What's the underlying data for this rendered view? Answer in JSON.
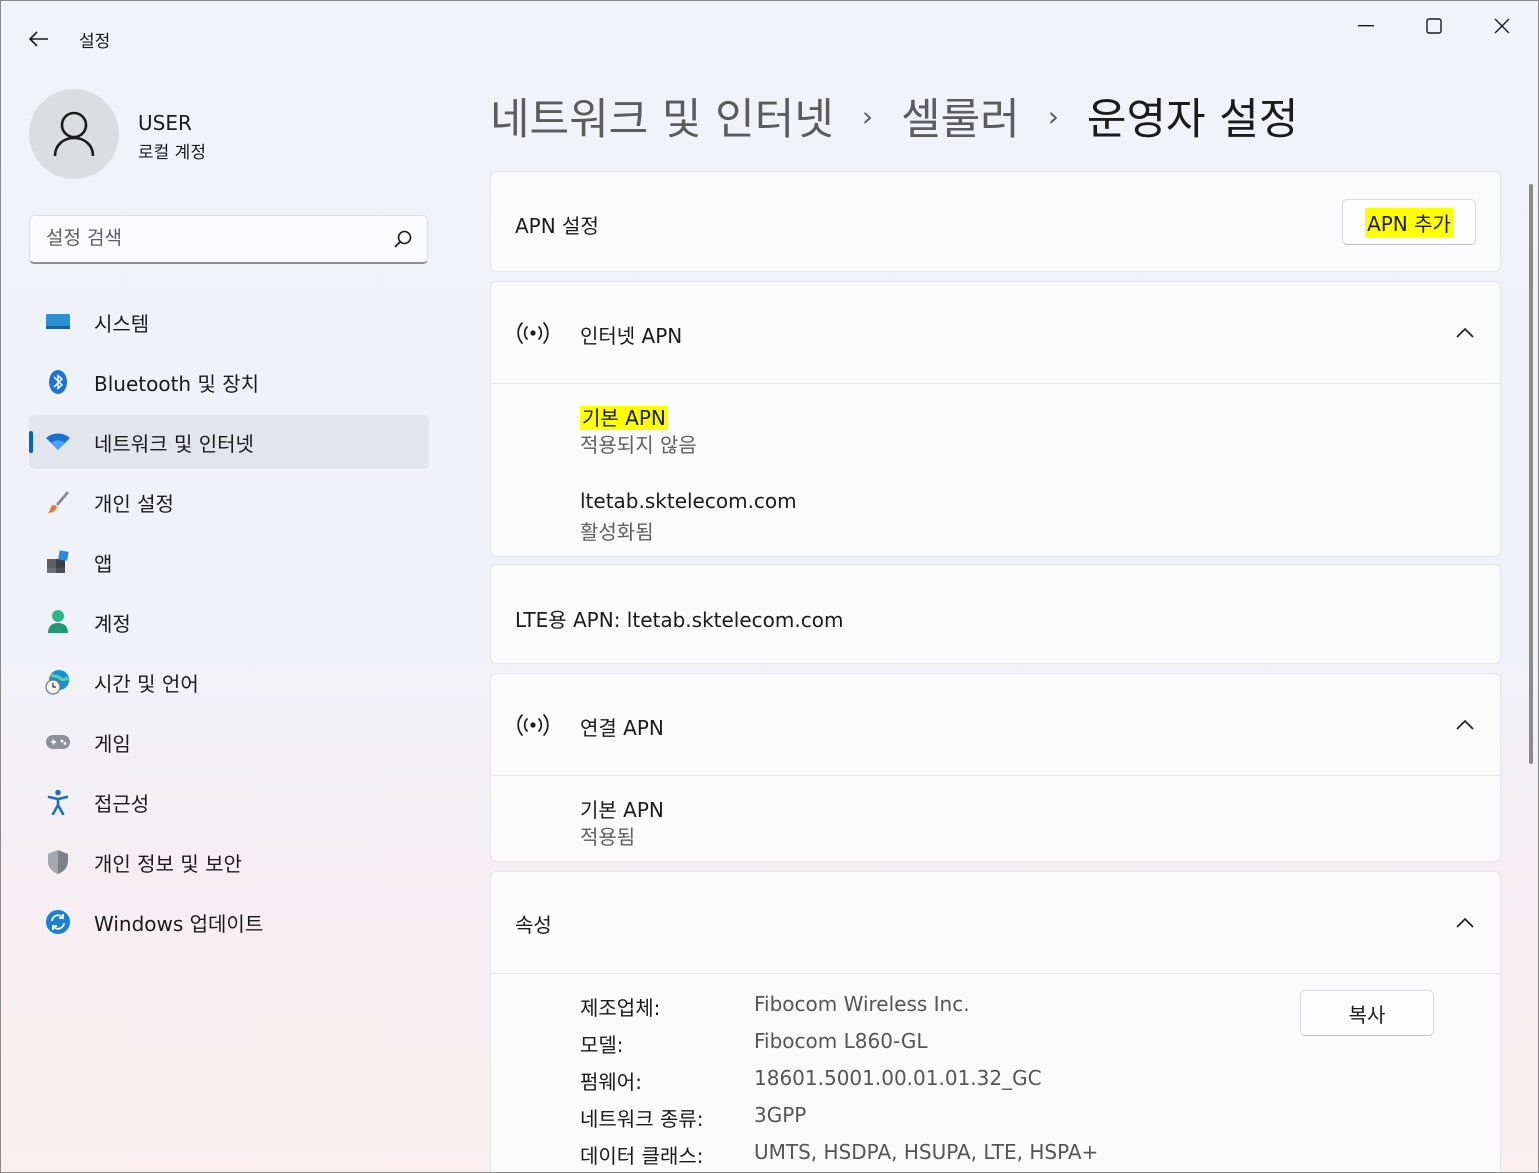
{
  "window": {
    "title": "설정"
  },
  "user": {
    "name": "USER",
    "account_type": "로컬 계정"
  },
  "search": {
    "placeholder": "설정 검색"
  },
  "sidebar": {
    "items": [
      {
        "label": "시스템",
        "icon": "system-icon"
      },
      {
        "label": "Bluetooth 및 장치",
        "icon": "bluetooth-icon"
      },
      {
        "label": "네트워크 및 인터넷",
        "icon": "wifi-icon",
        "active": true
      },
      {
        "label": "개인 설정",
        "icon": "brush-icon"
      },
      {
        "label": "앱",
        "icon": "apps-icon"
      },
      {
        "label": "계정",
        "icon": "account-icon"
      },
      {
        "label": "시간 및 언어",
        "icon": "globe-clock-icon"
      },
      {
        "label": "게임",
        "icon": "gamepad-icon"
      },
      {
        "label": "접근성",
        "icon": "accessibility-icon"
      },
      {
        "label": "개인 정보 및 보안",
        "icon": "shield-icon"
      },
      {
        "label": "Windows 업데이트",
        "icon": "update-icon"
      }
    ]
  },
  "breadcrumb": {
    "items": [
      "네트워크 및 인터넷",
      "셀룰러"
    ],
    "separator": "›",
    "current": "운영자 설정"
  },
  "apn_settings": {
    "title": "APN 설정",
    "add_button": "APN 추가"
  },
  "internet_apn": {
    "title": "인터넷 APN",
    "entries": [
      {
        "name": "기본 APN",
        "status": "적용되지 않음"
      },
      {
        "name": "ltetab.sktelecom.com",
        "status": "활성화됨"
      }
    ]
  },
  "lte_apn": {
    "text": "LTE용 APN: ltetab.sktelecom.com"
  },
  "attach_apn": {
    "title": "연결 APN",
    "entries": [
      {
        "name": "기본 APN",
        "status": "적용됨"
      }
    ]
  },
  "properties": {
    "title": "속성",
    "copy_button": "복사",
    "rows": [
      {
        "label": "제조업체:",
        "value": "Fibocom Wireless Inc."
      },
      {
        "label": "모델:",
        "value": "Fibocom L860-GL"
      },
      {
        "label": "펌웨어:",
        "value": "18601.5001.00.01.01.32_GC"
      },
      {
        "label": "네트워크 종류:",
        "value": "3GPP"
      },
      {
        "label": "데이터 클래스:",
        "value": "UMTS, HSDPA, HSUPA, LTE, HSPA+"
      }
    ]
  },
  "colors": {
    "accent": "#0067c0",
    "highlight": "#ffff00"
  }
}
